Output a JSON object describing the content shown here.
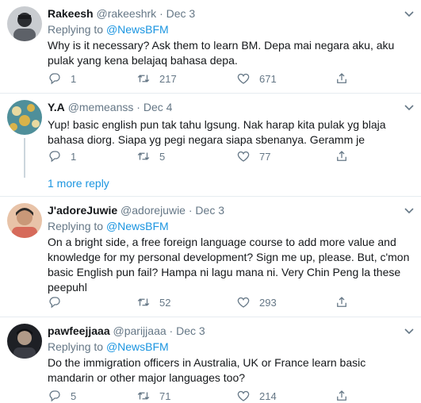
{
  "tweets": [
    {
      "name": "Rakeesh",
      "handle": "@rakeeshrk",
      "date": "Dec 3",
      "reply_prefix": "Replying to",
      "reply_mention": "@NewsBFM",
      "text": "Why is it necessary?  Ask them to learn BM.  Depa mai negara aku,  aku pulak yang kena belajaq bahasa depa.",
      "replies": "1",
      "retweets": "217",
      "likes": "671",
      "avatar_colors": [
        "#c9ccd0",
        "#5d6168",
        "#2b2d31"
      ]
    },
    {
      "name": "Y.A",
      "handle": "@memeanss",
      "date": "Dec 4",
      "reply_prefix": "Replying to",
      "reply_mention": "@NewsBFM",
      "text": "Yup! basic english pun tak tahu lgsung. Nak harap kita pulak yg blaja bahasa diorg. Siapa yg pegi negara siapa sbenanya. Geramm je",
      "replies": "1",
      "retweets": "5",
      "likes": "77",
      "avatar_colors": [
        "#4f8f9a",
        "#d9b34a",
        "#e8d9a0"
      ]
    },
    {
      "name": "J'adoreJuwie",
      "handle": "@adorejuwie",
      "date": "Dec 3",
      "reply_prefix": "Replying to",
      "reply_mention": "@NewsBFM",
      "text": "On a bright side, a free foreign language course to add more value and knowledge for my personal development? Sign me up, please. But, c'mon basic English pun fail? Hampa ni lagu mana ni. Very Chin Peng la these peepuhl",
      "replies": "",
      "retweets": "52",
      "likes": "293",
      "avatar_colors": [
        "#d66a5a",
        "#2c2a28",
        "#e8c3a8"
      ]
    },
    {
      "name": "pawfeejjaaa",
      "handle": "@parijjaaa",
      "date": "Dec 3",
      "reply_prefix": "Replying to",
      "reply_mention": "@NewsBFM",
      "text": "Do the immigration officers in Australia, UK or France learn basic mandarin or other major languages too?",
      "replies": "5",
      "retweets": "71",
      "likes": "214",
      "avatar_colors": [
        "#1e2025",
        "#b09a88",
        "#3a3c44"
      ]
    }
  ],
  "more_replies": "1 more reply",
  "colors": {
    "link": "#1b95e0",
    "muted": "#657786",
    "divider": "#e6ecf0",
    "thread": "#ccd6dd"
  },
  "icons": {
    "reply": "reply-icon",
    "retweet": "retweet-icon",
    "like": "heart-icon",
    "share": "share-icon",
    "menu": "chevron-down-icon"
  }
}
